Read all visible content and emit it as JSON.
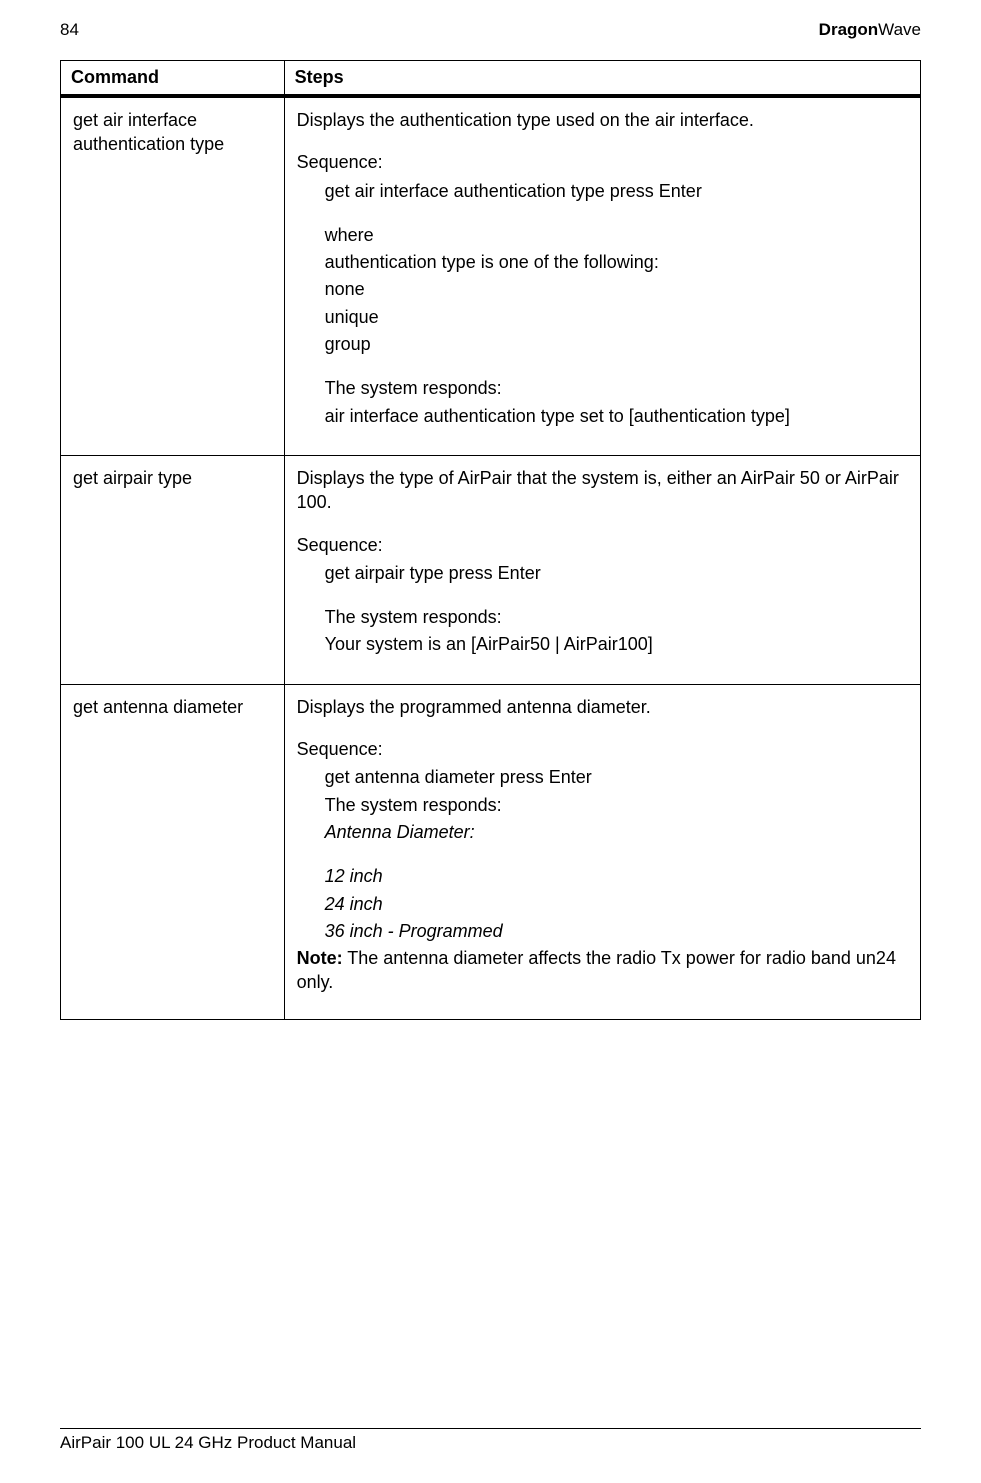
{
  "header": {
    "page_number": "84",
    "brand_bold": "Dragon",
    "brand_light": "Wave"
  },
  "table": {
    "headers": {
      "command": "Command",
      "steps": "Steps"
    },
    "rows": [
      {
        "command": "get air interface authentication type",
        "intro": "Displays the authentication type used on the air interface.",
        "sequence_label": "Sequence:",
        "lines": [
          "get air interface authentication type press Enter",
          "",
          "where",
          "authentication type is one of the following:",
          "none",
          "unique",
          "group",
          "",
          "The system responds:",
          "air interface authentication type set to [authentication type]"
        ]
      },
      {
        "command": "get airpair type",
        "intro": "Displays the type of AirPair that the system is, either an AirPair 50 or AirPair 100.",
        "sequence_label": "Sequence:",
        "lines": [
          "get airpair type press Enter",
          "",
          "The system responds:",
          "Your system is an  [AirPair50 | AirPair100]"
        ]
      },
      {
        "command": "get antenna diameter",
        "intro": "Displays the programmed antenna diameter.",
        "sequence_label": "Sequence:",
        "lines": [
          "get antenna diameter press Enter",
          "The system responds:"
        ],
        "italic_lines": [
          "Antenna Diameter:",
          "",
          "12 inch",
          "24 inch",
          "36 inch - Programmed"
        ],
        "note_bold": "Note:",
        "note_rest": " The antenna diameter affects the radio Tx power for radio band un24 only."
      }
    ]
  },
  "footer": "AirPair 100 UL 24 GHz Product Manual"
}
